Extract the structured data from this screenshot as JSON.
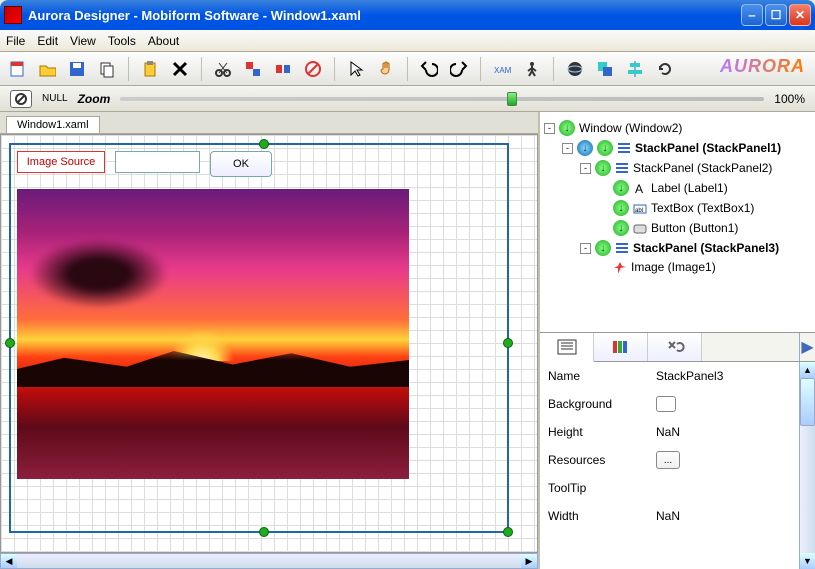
{
  "title": "Aurora Designer - Mobiform Software - Window1.xaml",
  "menus": [
    "File",
    "Edit",
    "View",
    "Tools",
    "About"
  ],
  "zoom": {
    "null_label": "NULL",
    "label": "Zoom",
    "value": "100%"
  },
  "toolbar_icons": [
    "new",
    "open",
    "save",
    "copy",
    "paste",
    "delete",
    "cut",
    "group",
    "ungroup",
    "no",
    "cursor",
    "hand",
    "undo",
    "redo",
    "xaml",
    "run",
    "globe",
    "front",
    "align",
    "refresh"
  ],
  "logo": "AURORA",
  "doc_tab": "Window1.xaml",
  "canvas": {
    "label": "Image Source",
    "ok": "OK"
  },
  "tree": [
    {
      "level": 0,
      "exp": "-",
      "circles": [
        "green"
      ],
      "label": "Window (Window2)"
    },
    {
      "level": 1,
      "exp": "-",
      "circles": [
        "blue",
        "green"
      ],
      "label": "StackPanel (StackPanel1)",
      "bold": true,
      "stack_icon": true
    },
    {
      "level": 2,
      "exp": "-",
      "circles": [
        "green"
      ],
      "label": "StackPanel (StackPanel2)",
      "stack_icon": true
    },
    {
      "level": 3,
      "circles": [
        "green"
      ],
      "label": "Label (Label1)",
      "glyph": "A"
    },
    {
      "level": 3,
      "circles": [
        "green"
      ],
      "label": "TextBox (TextBox1)",
      "glyph": "txt"
    },
    {
      "level": 3,
      "circles": [
        "green"
      ],
      "label": "Button (Button1)",
      "glyph": "btn"
    },
    {
      "level": 2,
      "exp": "-",
      "circles": [
        "green"
      ],
      "label": "StackPanel (StackPanel3)",
      "bold": true,
      "stack_icon": true
    },
    {
      "level": 3,
      "label": "Image (Image1)",
      "glyph": "img"
    }
  ],
  "props": {
    "Name": "StackPanel3",
    "Background": "",
    "Height": "NaN",
    "Resources": "...",
    "ToolTip": "",
    "Width": "NaN"
  },
  "prop_order": [
    "Name",
    "Background",
    "Height",
    "Resources",
    "ToolTip",
    "Width"
  ]
}
